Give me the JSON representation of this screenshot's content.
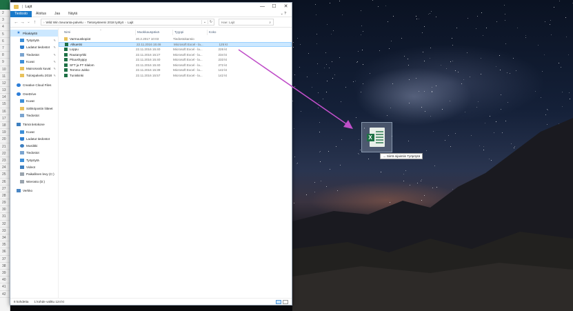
{
  "window": {
    "title": "Lajit",
    "title_separator": "|",
    "controls": {
      "minimize": "—",
      "maximize": "☐",
      "close": "✕"
    }
  },
  "ribbon": {
    "tabs": [
      {
        "label": "Tiedosto",
        "active": true
      },
      {
        "label": "Aloitus"
      },
      {
        "label": "Jaa"
      },
      {
        "label": "Näytä"
      }
    ]
  },
  "address": {
    "segments": [
      "Wild Win Seuranta-palvelu",
      "Tietosysteemi 2018 työtyö",
      "Lajit"
    ],
    "search_placeholder": "Hae: Lajit"
  },
  "nav": {
    "items": [
      {
        "label": "Pikakäyttö",
        "icon": "star-icon",
        "active": true
      },
      {
        "label": "Työpöytä",
        "icon": "desktop-icon",
        "pinned": true
      },
      {
        "label": "Ladatut tiedostot",
        "icon": "download-icon",
        "pinned": true
      },
      {
        "label": "Tiedostot",
        "icon": "documents-icon",
        "pinned": true
      },
      {
        "label": "Kuvat",
        "icon": "pictures-icon",
        "pinned": true
      },
      {
        "label": "Mainosvalo kuvat",
        "icon": "folder-icon",
        "pinned": true
      },
      {
        "label": "Tulospalvelu 2018",
        "icon": "folder-icon",
        "pinned": true
      },
      {
        "label": "Creative Cloud Files",
        "icon": "cloud-icon"
      },
      {
        "label": "OneDrive",
        "icon": "cloud-icon"
      },
      {
        "label": "Kuvat",
        "icon": "pictures-icon"
      },
      {
        "label": "Sähköpostin liitteet",
        "icon": "folder-icon"
      },
      {
        "label": "Tiedostot",
        "icon": "documents-icon"
      },
      {
        "label": "Tämä tietokone",
        "icon": "pc-icon"
      },
      {
        "label": "Kuvat",
        "icon": "pictures-icon"
      },
      {
        "label": "Ladatut tiedostot",
        "icon": "download-icon"
      },
      {
        "label": "Musiikki",
        "icon": "music-icon"
      },
      {
        "label": "Tiedostot",
        "icon": "documents-icon"
      },
      {
        "label": "Työpöytä",
        "icon": "desktop-icon"
      },
      {
        "label": "Videot",
        "icon": "videos-icon"
      },
      {
        "label": "Paikallinen levy (C:)",
        "icon": "drive-icon"
      },
      {
        "label": "Wierosto (D:)",
        "icon": "drive-icon"
      },
      {
        "label": "Verkko",
        "icon": "network-icon"
      }
    ]
  },
  "files": {
    "headers": {
      "name": "Nimi",
      "modified": "Muokkauspäivä",
      "type": "Tyyppi",
      "size": "Koko"
    },
    "rows": [
      {
        "name": "Varmuuskopiot",
        "modified": "20.2.2017 10:03",
        "type": "Tiedostokansio",
        "size": "",
        "icon": "folder",
        "selected": false
      },
      {
        "name": "Alkuerät",
        "modified": "22.11.2016 15:46",
        "type": "Microsoft Excel - la...",
        "size": "125 kt",
        "icon": "excel",
        "selected": true
      },
      {
        "name": "Loppu",
        "modified": "22.11.2016 15:40",
        "type": "Microsoft Excel - la...",
        "size": "226 kt",
        "icon": "excel",
        "selected": false
      },
      {
        "name": "Rautanyrkki",
        "modified": "22.11.2016 15:27",
        "type": "Microsoft Excel - la...",
        "size": "234 kt",
        "icon": "excel",
        "selected": false
      },
      {
        "name": "Pituushyppy",
        "modified": "22.11.2016 15:40",
        "type": "Microsoft Excel - la...",
        "size": "233 kt",
        "icon": "excel",
        "selected": false
      },
      {
        "name": "SFT ja FT Slalom",
        "modified": "22.11.2016 15:40",
        "type": "Microsoft Excel - la...",
        "size": "272 kt",
        "icon": "excel",
        "selected": false
      },
      {
        "name": "Temmo-Jukko",
        "modified": "22.11.2016 15:39",
        "type": "Microsoft Excel - la...",
        "size": "142 kt",
        "icon": "excel",
        "selected": false
      },
      {
        "name": "Tuniskinki",
        "modified": "22.11.2016 15:57",
        "type": "Microsoft Excel - la...",
        "size": "142 kt",
        "icon": "excel",
        "selected": false
      }
    ]
  },
  "status": {
    "count": "8 kohdetta",
    "selection": "1 kohde valittu 124 kt"
  },
  "drag": {
    "tooltip_arrow": "→",
    "tooltip": "Siirrä sijaintiin Työpöytä"
  },
  "excel_strip": {
    "rows": [
      "2",
      "3",
      "4",
      "5",
      "6",
      "7",
      "8",
      "9",
      "10",
      "11",
      "12",
      "13",
      "14",
      "15",
      "16",
      "17",
      "18",
      "19",
      "20",
      "21",
      "22",
      "23",
      "24",
      "25",
      "26",
      "27",
      "28",
      "29",
      "30",
      "31",
      "32",
      "33",
      "34",
      "35",
      "36",
      "37",
      "38",
      "39",
      "40",
      "41",
      "42"
    ]
  },
  "colors": {
    "accent": "#1979ca",
    "selection": "#cce8ff",
    "excel_green": "#1e7145",
    "drag_arrow": "#c04fc9"
  }
}
